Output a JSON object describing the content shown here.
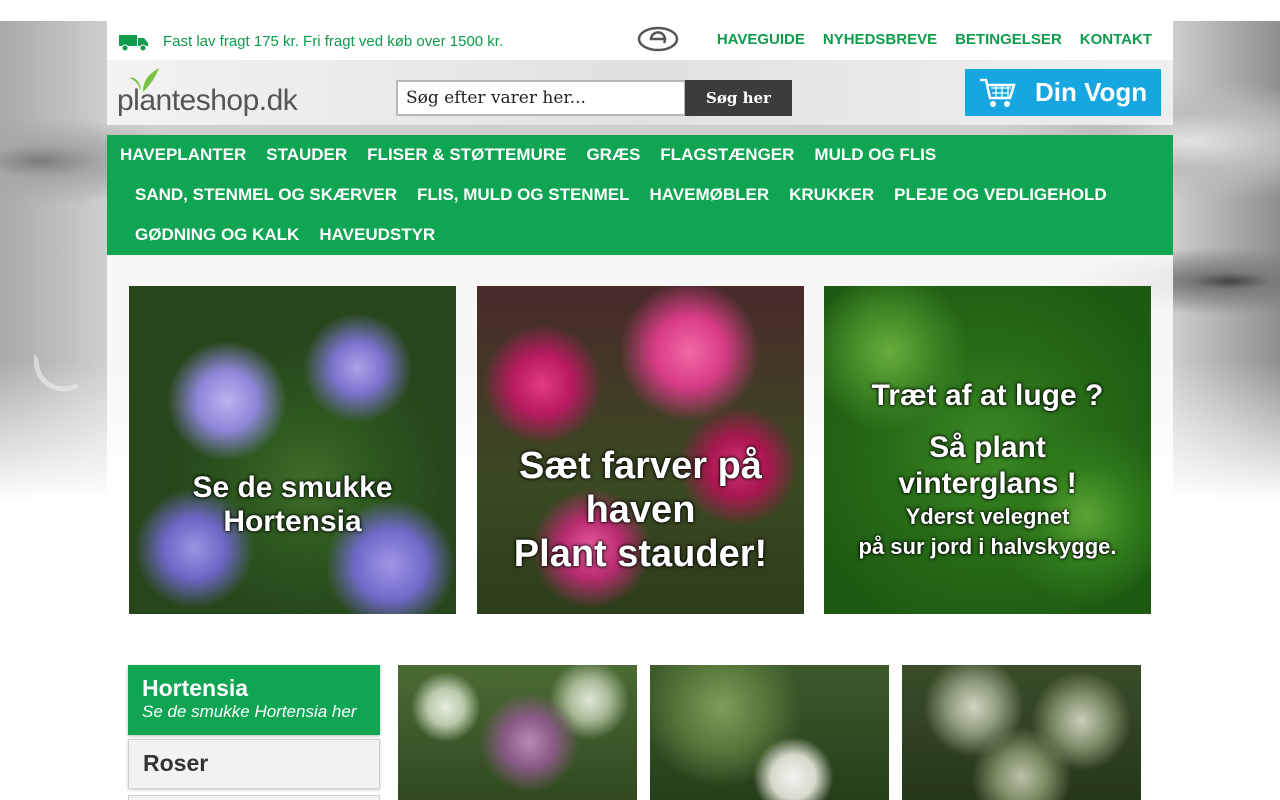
{
  "topbar": {
    "shipping_text": "Fast lav fragt 175 kr. Fri fragt ved køb over 1500 kr.",
    "links": [
      "HAVEGUIDE",
      "NYHEDSBREVE",
      "BETINGELSER",
      "KONTAKT"
    ]
  },
  "header": {
    "logo_text": "planteshop.dk",
    "search_placeholder": "Søg efter varer her...",
    "search_button": "Søg her",
    "cart_label": "Din Vogn"
  },
  "nav": {
    "row1": [
      "HAVEPLANTER",
      "STAUDER",
      "FLISER & STØTTEMURE",
      "GRÆS",
      "FLAGSTÆNGER",
      "MULD OG FLIS"
    ],
    "row2": [
      "SAND, STENMEL OG SKÆRVER",
      "FLIS, MULD OG STENMEL",
      "HAVEMØBLER",
      "KRUKKER",
      "PLEJE OG VEDLIGEHOLD"
    ],
    "row3": [
      "GØDNING OG KALK",
      "HAVEUDSTYR"
    ]
  },
  "banners": {
    "b1": [
      "Se de smukke",
      "Hortensia"
    ],
    "b2": [
      "Sæt farver på",
      "haven",
      "Plant stauder!"
    ],
    "b3": [
      "Træt af at luge ?",
      "Så plant",
      "vinterglans !",
      "Yderst velegnet",
      "på sur jord i halvskygge."
    ]
  },
  "sidebar": {
    "hortensia_title": "Hortensia",
    "hortensia_sub": "Se de smukke Hortensia her",
    "roser_title": "Roser"
  },
  "colors": {
    "brand_green": "#0fa552",
    "cart_blue": "#16a6e0",
    "search_button_bg": "#3c3c3c"
  },
  "icons": [
    "truck-icon",
    "e-mark-icon",
    "leaf-icon",
    "cart-icon"
  ]
}
